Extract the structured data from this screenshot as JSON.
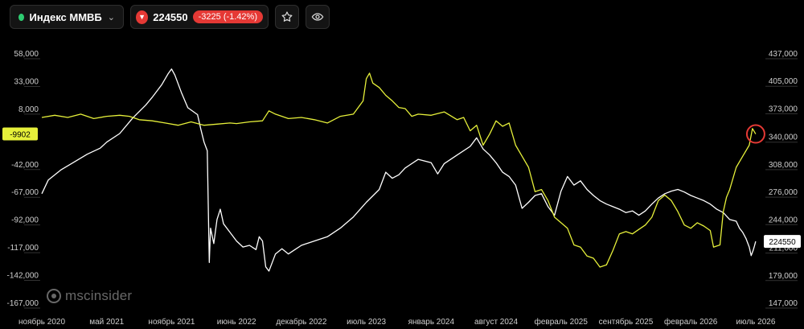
{
  "header": {
    "index_name": "Индекс ММВБ",
    "status_color": "#2ecc71",
    "price": "224550",
    "change": "-3225 (-1.42%)",
    "star_icon": "star-icon",
    "eye_icon": "eye-icon"
  },
  "watermark": {
    "text": "mscinsider"
  },
  "chart_data": {
    "type": "line",
    "title": "",
    "colors": {
      "background": "#000000",
      "white_series": "#ffffff",
      "yellow_series": "#e6f03a",
      "highlight_circle": "#e53935",
      "price_badge": "#ffffff",
      "left_badge": "#e6f03a"
    },
    "x_labels": [
      "ноябрь 2020",
      "май 2021",
      "ноябрь 2021",
      "июнь 2022",
      "декабрь 2022",
      "июль 2023",
      "январь 2024",
      "август 2024",
      "февраль 2025",
      "сентябрь 2025",
      "февраль 2026",
      "июль 2026"
    ],
    "x_range": [
      0,
      11.1
    ],
    "left_axis": {
      "ticks": [
        "58,000",
        "33,000",
        "8,000",
        "-42,000",
        "-67,000",
        "-92,000",
        "-117,000",
        "-142,000",
        "-167,000"
      ],
      "range": [
        -167000,
        58000
      ],
      "current_label": "-9902"
    },
    "right_axis": {
      "ticks": [
        "437,000",
        "405,000",
        "373,000",
        "340,000",
        "308,000",
        "276,000",
        "244,000",
        "211,000",
        "179,000",
        "147,000"
      ],
      "range": [
        147000,
        437000
      ],
      "current_label": "224550"
    },
    "grid": false,
    "series": [
      {
        "axis": "right",
        "color": "#ffffff",
        "points": [
          [
            0.0,
            280000
          ],
          [
            0.1,
            296000
          ],
          [
            0.3,
            308000
          ],
          [
            0.5,
            317000
          ],
          [
            0.7,
            326000
          ],
          [
            0.9,
            333000
          ],
          [
            1.0,
            340000
          ],
          [
            1.2,
            350000
          ],
          [
            1.4,
            368000
          ],
          [
            1.6,
            383000
          ],
          [
            1.7,
            392000
          ],
          [
            1.85,
            407000
          ],
          [
            1.95,
            420000
          ],
          [
            2.0,
            425000
          ],
          [
            2.05,
            418000
          ],
          [
            2.15,
            398000
          ],
          [
            2.25,
            380000
          ],
          [
            2.4,
            372000
          ],
          [
            2.45,
            355000
          ],
          [
            2.5,
            340000
          ],
          [
            2.55,
            330000
          ],
          [
            2.58,
            200000
          ],
          [
            2.6,
            240000
          ],
          [
            2.65,
            222000
          ],
          [
            2.7,
            250000
          ],
          [
            2.75,
            262000
          ],
          [
            2.8,
            245000
          ],
          [
            2.9,
            235000
          ],
          [
            3.0,
            225000
          ],
          [
            3.1,
            218000
          ],
          [
            3.2,
            220000
          ],
          [
            3.3,
            215000
          ],
          [
            3.35,
            230000
          ],
          [
            3.4,
            225000
          ],
          [
            3.45,
            195000
          ],
          [
            3.5,
            190000
          ],
          [
            3.55,
            200000
          ],
          [
            3.6,
            210000
          ],
          [
            3.7,
            216000
          ],
          [
            3.8,
            210000
          ],
          [
            3.9,
            215000
          ],
          [
            4.0,
            220000
          ],
          [
            4.2,
            225000
          ],
          [
            4.4,
            230000
          ],
          [
            4.6,
            240000
          ],
          [
            4.8,
            253000
          ],
          [
            5.0,
            270000
          ],
          [
            5.2,
            285000
          ],
          [
            5.3,
            305000
          ],
          [
            5.4,
            298000
          ],
          [
            5.5,
            302000
          ],
          [
            5.6,
            310000
          ],
          [
            5.8,
            320000
          ],
          [
            6.0,
            316000
          ],
          [
            6.1,
            303000
          ],
          [
            6.2,
            315000
          ],
          [
            6.4,
            325000
          ],
          [
            6.6,
            335000
          ],
          [
            6.7,
            345000
          ],
          [
            6.8,
            332000
          ],
          [
            6.9,
            325000
          ],
          [
            7.0,
            316000
          ],
          [
            7.1,
            305000
          ],
          [
            7.2,
            300000
          ],
          [
            7.3,
            290000
          ],
          [
            7.4,
            263000
          ],
          [
            7.5,
            270000
          ],
          [
            7.6,
            278000
          ],
          [
            7.7,
            280000
          ],
          [
            7.8,
            265000
          ],
          [
            7.9,
            255000
          ],
          [
            8.0,
            283000
          ],
          [
            8.1,
            300000
          ],
          [
            8.2,
            290000
          ],
          [
            8.3,
            295000
          ],
          [
            8.4,
            285000
          ],
          [
            8.5,
            278000
          ],
          [
            8.6,
            272000
          ],
          [
            8.7,
            268000
          ],
          [
            8.8,
            265000
          ],
          [
            8.9,
            262000
          ],
          [
            9.0,
            258000
          ],
          [
            9.1,
            260000
          ],
          [
            9.2,
            255000
          ],
          [
            9.3,
            260000
          ],
          [
            9.4,
            268000
          ],
          [
            9.5,
            275000
          ],
          [
            9.6,
            280000
          ],
          [
            9.7,
            283000
          ],
          [
            9.8,
            285000
          ],
          [
            9.9,
            282000
          ],
          [
            10.0,
            278000
          ],
          [
            10.1,
            275000
          ],
          [
            10.2,
            272000
          ],
          [
            10.3,
            268000
          ],
          [
            10.4,
            262000
          ],
          [
            10.5,
            258000
          ],
          [
            10.6,
            250000
          ],
          [
            10.7,
            248000
          ],
          [
            10.75,
            240000
          ],
          [
            10.8,
            235000
          ],
          [
            10.85,
            228000
          ],
          [
            10.9,
            218000
          ],
          [
            10.93,
            208000
          ],
          [
            10.96,
            214000
          ],
          [
            10.98,
            219000
          ],
          [
            11.0,
            224550
          ]
        ]
      },
      {
        "axis": "left",
        "color": "#e6f03a",
        "points": [
          [
            0.0,
            5000
          ],
          [
            0.2,
            7000
          ],
          [
            0.4,
            5000
          ],
          [
            0.6,
            8000
          ],
          [
            0.8,
            4000
          ],
          [
            1.0,
            6000
          ],
          [
            1.2,
            7000
          ],
          [
            1.35,
            6000
          ],
          [
            1.5,
            3000
          ],
          [
            1.7,
            2000
          ],
          [
            1.9,
            0
          ],
          [
            2.1,
            -2000
          ],
          [
            2.3,
            1000
          ],
          [
            2.5,
            -2000
          ],
          [
            2.7,
            -1000
          ],
          [
            2.9,
            0
          ],
          [
            3.0,
            -500
          ],
          [
            3.2,
            1000
          ],
          [
            3.4,
            2000
          ],
          [
            3.5,
            11000
          ],
          [
            3.6,
            8000
          ],
          [
            3.8,
            4000
          ],
          [
            4.0,
            5000
          ],
          [
            4.2,
            3000
          ],
          [
            4.4,
            0
          ],
          [
            4.6,
            6000
          ],
          [
            4.8,
            8000
          ],
          [
            4.95,
            20000
          ],
          [
            5.0,
            40000
          ],
          [
            5.05,
            45000
          ],
          [
            5.1,
            36000
          ],
          [
            5.2,
            32000
          ],
          [
            5.3,
            25000
          ],
          [
            5.4,
            20000
          ],
          [
            5.5,
            14000
          ],
          [
            5.6,
            13000
          ],
          [
            5.7,
            6000
          ],
          [
            5.8,
            8000
          ],
          [
            6.0,
            7000
          ],
          [
            6.2,
            10000
          ],
          [
            6.4,
            3000
          ],
          [
            6.5,
            5000
          ],
          [
            6.6,
            -7000
          ],
          [
            6.7,
            -2000
          ],
          [
            6.8,
            -20000
          ],
          [
            6.9,
            -10000
          ],
          [
            7.0,
            2000
          ],
          [
            7.1,
            -3000
          ],
          [
            7.2,
            0
          ],
          [
            7.3,
            -20000
          ],
          [
            7.4,
            -30000
          ],
          [
            7.5,
            -40000
          ],
          [
            7.6,
            -62000
          ],
          [
            7.7,
            -60000
          ],
          [
            7.8,
            -70000
          ],
          [
            7.9,
            -85000
          ],
          [
            8.0,
            -90000
          ],
          [
            8.1,
            -95000
          ],
          [
            8.2,
            -110000
          ],
          [
            8.3,
            -112000
          ],
          [
            8.4,
            -120000
          ],
          [
            8.5,
            -122000
          ],
          [
            8.6,
            -130000
          ],
          [
            8.7,
            -128000
          ],
          [
            8.8,
            -115000
          ],
          [
            8.9,
            -100000
          ],
          [
            9.0,
            -98000
          ],
          [
            9.1,
            -100000
          ],
          [
            9.2,
            -96000
          ],
          [
            9.3,
            -92000
          ],
          [
            9.4,
            -85000
          ],
          [
            9.5,
            -70000
          ],
          [
            9.6,
            -65000
          ],
          [
            9.7,
            -70000
          ],
          [
            9.8,
            -80000
          ],
          [
            9.9,
            -92000
          ],
          [
            10.0,
            -95000
          ],
          [
            10.1,
            -90000
          ],
          [
            10.2,
            -93000
          ],
          [
            10.3,
            -97000
          ],
          [
            10.35,
            -112000
          ],
          [
            10.45,
            -110000
          ],
          [
            10.5,
            -80000
          ],
          [
            10.55,
            -67000
          ],
          [
            10.6,
            -60000
          ],
          [
            10.7,
            -40000
          ],
          [
            10.8,
            -30000
          ],
          [
            10.9,
            -20000
          ],
          [
            10.95,
            -5000
          ],
          [
            11.0,
            -9902
          ]
        ]
      }
    ]
  }
}
